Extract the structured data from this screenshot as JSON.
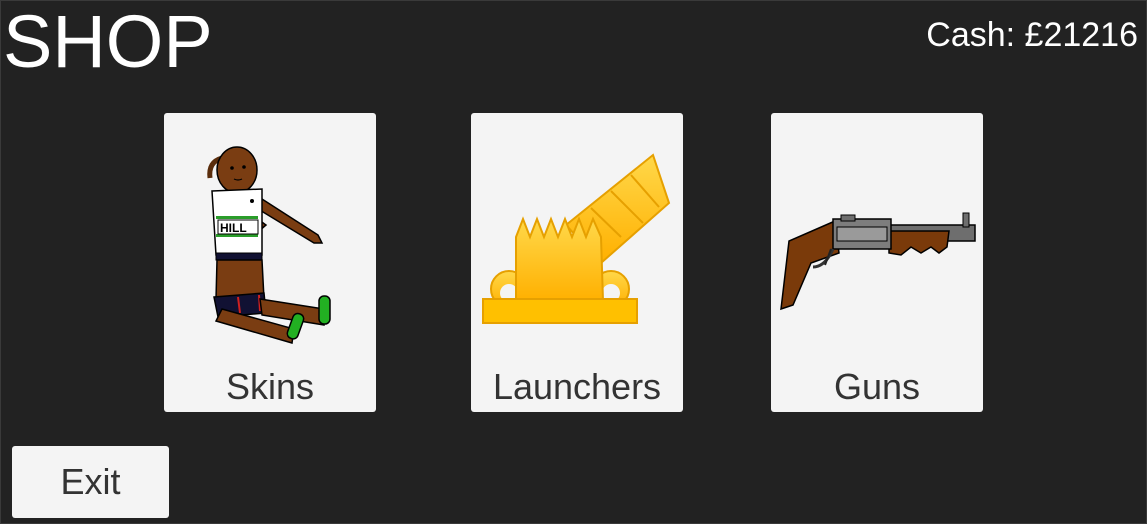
{
  "header": {
    "title": "SHOP",
    "cash": "Cash: £21216"
  },
  "cards": [
    {
      "label": "Skins",
      "icon": "athlete-skin-icon"
    },
    {
      "label": "Launchers",
      "icon": "cannon-launcher-icon"
    },
    {
      "label": "Guns",
      "icon": "shotgun-icon"
    }
  ],
  "skin_bib_text": "HILL",
  "exit_label": "Exit",
  "colors": {
    "background": "#222222",
    "card": "#f4f4f4",
    "card_text": "#333333",
    "header_text": "#ffffff",
    "gold": "#ffc000"
  }
}
